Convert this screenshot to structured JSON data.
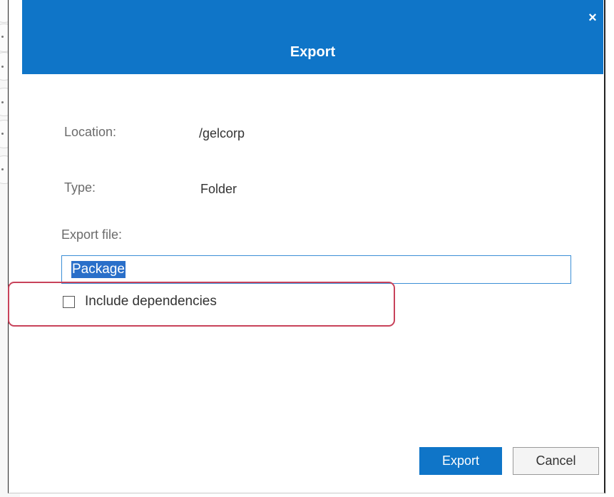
{
  "dialog": {
    "title": "Export",
    "close_icon": "×"
  },
  "fields": {
    "location_label": "Location:",
    "location_value": "/gelcorp",
    "type_label": "Type:",
    "type_value": "Folder",
    "export_file_label": "Export file:",
    "export_file_value": "Package"
  },
  "options": {
    "include_dependencies_label": "Include dependencies",
    "include_dependencies_checked": false
  },
  "buttons": {
    "export_label": "Export",
    "cancel_label": "Cancel"
  },
  "colors": {
    "header": "#0f75c8",
    "highlight": "#c8425a",
    "selection": "#2a6fc9"
  }
}
